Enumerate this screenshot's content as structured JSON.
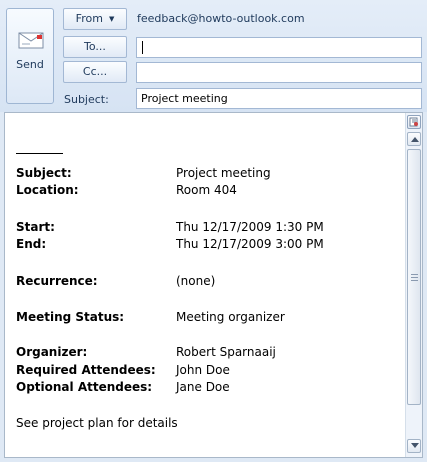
{
  "header": {
    "send_label": "Send",
    "from_label": "From",
    "from_value": "feedback@howto-outlook.com",
    "to_label": "To...",
    "cc_label": "Cc...",
    "subject_label": "Subject:",
    "to_value": "",
    "cc_value": "",
    "subject_value": "Project meeting"
  },
  "body": {
    "rows": [
      {
        "key": "Subject:",
        "value": "Project meeting"
      },
      {
        "key": "Location:",
        "value": "Room 404"
      },
      {
        "key": "Start:",
        "value": "Thu 12/17/2009 1:30 PM"
      },
      {
        "key": "End:",
        "value": "Thu 12/17/2009 3:00 PM"
      },
      {
        "key": "Recurrence:",
        "value": "(none)"
      },
      {
        "key": "Meeting Status:",
        "value": "Meeting organizer"
      },
      {
        "key": "Organizer:",
        "value": "Robert Sparnaaij"
      },
      {
        "key": "Required Attendees:",
        "value": "John Doe"
      },
      {
        "key": "Optional Attendees:",
        "value": "Jane Doe"
      }
    ],
    "note": "See project plan for details"
  },
  "icons": {
    "send": "envelope-send-icon",
    "scroll_top": "page-icon",
    "scroll_up": "arrow-up-icon",
    "scroll_down": "arrow-down-icon"
  }
}
